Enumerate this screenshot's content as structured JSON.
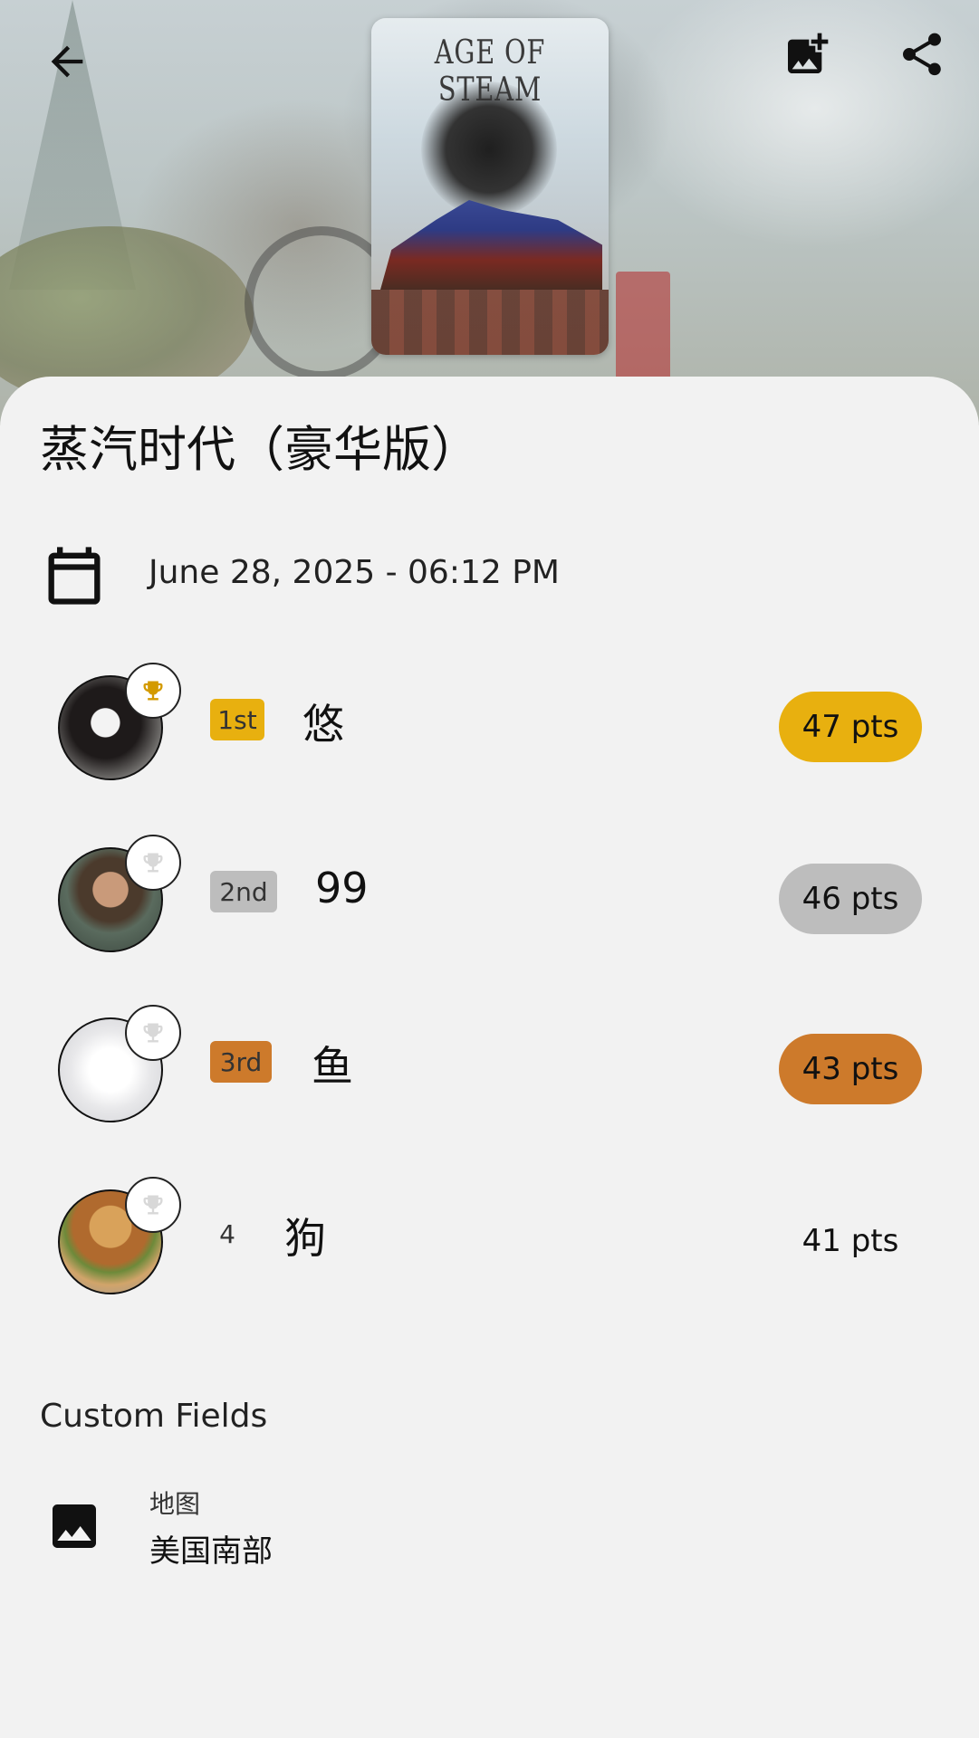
{
  "header": {
    "back_icon": "arrow-left-icon",
    "add_photo_icon": "add-photo-icon",
    "share_icon": "share-icon",
    "cover_title": "AGE OF STEAM"
  },
  "game": {
    "title": "蒸汽时代（豪华版）",
    "date": "June 28, 2025 - 06:12 PM",
    "date_icon": "calendar-icon"
  },
  "players": [
    {
      "rank": "1st",
      "name": "悠",
      "points": "47 pts",
      "rank_color": "#e8b00f",
      "pts_color": "#e8b00f",
      "trophy_color": "#d39a00"
    },
    {
      "rank": "2nd",
      "name": "99",
      "points": "46 pts",
      "rank_color": "#bdbdbd",
      "pts_color": "#bdbdbd",
      "trophy_color": "#d8d8d8"
    },
    {
      "rank": "3rd",
      "name": "鱼",
      "points": "43 pts",
      "rank_color": "#cd7a2b",
      "pts_color": "#cd7a2b",
      "trophy_color": "#d8d8d8"
    },
    {
      "rank": "4",
      "name": "狗",
      "points": "41 pts",
      "rank_color": "transparent",
      "pts_color": "transparent",
      "trophy_color": "#d8d8d8"
    }
  ],
  "custom_fields": {
    "title": "Custom Fields",
    "items": [
      {
        "icon": "image-icon",
        "label": "地图",
        "value": "美国南部"
      }
    ]
  }
}
